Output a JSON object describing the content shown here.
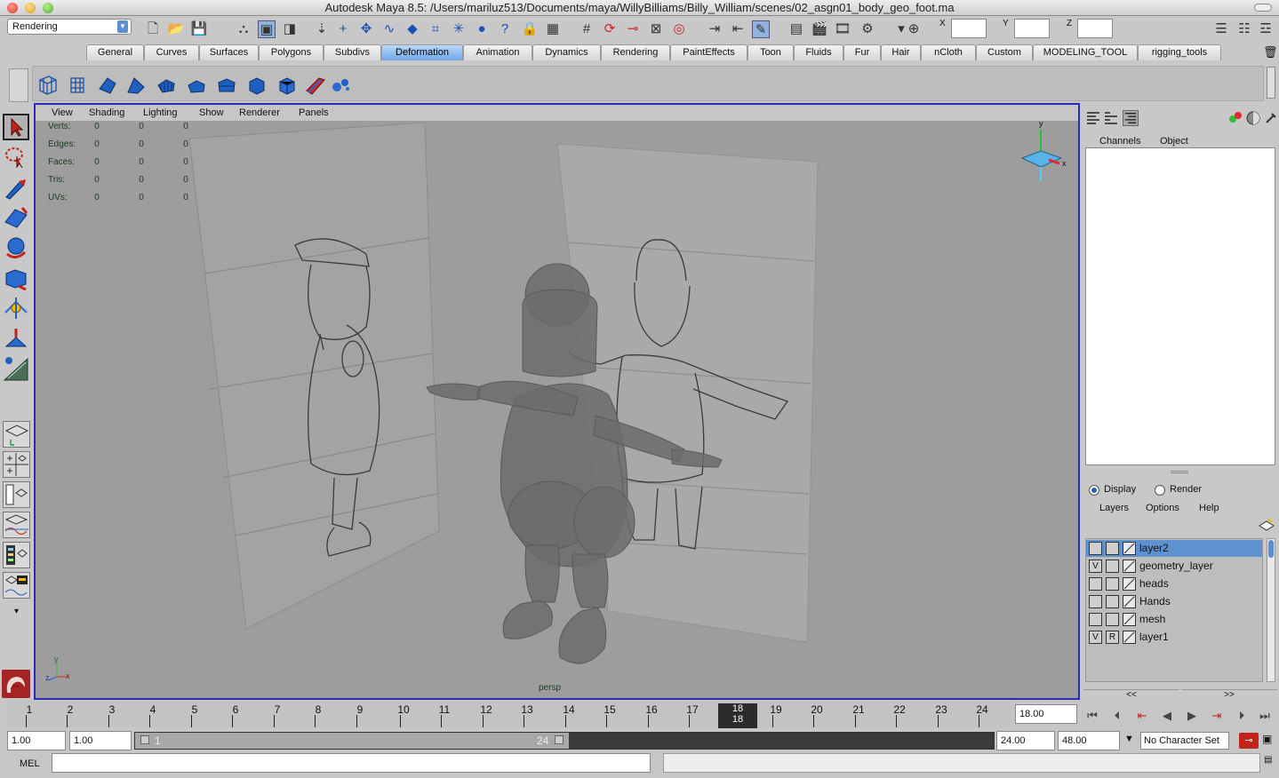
{
  "window": {
    "title": "Autodesk Maya 8.5: /Users/mariluz513/Documents/maya/WillyBilliams/Billy_William/scenes/02_asgn01_body_geo_foot.ma"
  },
  "status_line": {
    "menu_set": "Rendering",
    "x_label": "X",
    "y_label": "Y",
    "z_label": "Z",
    "x_value": "",
    "y_value": "",
    "z_value": ""
  },
  "shelf_tabs": [
    "General",
    "Curves",
    "Surfaces",
    "Polygons",
    "Subdivs",
    "Deformation",
    "Animation",
    "Dynamics",
    "Rendering",
    "PaintEffects",
    "Toon",
    "Fluids",
    "Fur",
    "Hair",
    "nCloth",
    "Custom",
    "MODELING_TOOL",
    "rigging_tools"
  ],
  "active_shelf_tab": "Deformation",
  "viewport": {
    "menu": [
      "View",
      "Shading",
      "Lighting",
      "Show",
      "Renderer",
      "Panels"
    ],
    "hud": [
      {
        "label": "Verts:",
        "values": [
          "0",
          "0",
          "0"
        ]
      },
      {
        "label": "Edges:",
        "values": [
          "0",
          "0",
          "0"
        ]
      },
      {
        "label": "Faces:",
        "values": [
          "0",
          "0",
          "0"
        ]
      },
      {
        "label": "Tris:",
        "values": [
          "0",
          "0",
          "0"
        ]
      },
      {
        "label": "UVs:",
        "values": [
          "0",
          "0",
          "0"
        ]
      }
    ],
    "camera_label": "persp",
    "view_cube_y": "y",
    "view_cube_x": "x",
    "axis_y": "y",
    "axis_z": "z",
    "axis_x": "x"
  },
  "channel_box": {
    "menu": [
      "Channels",
      "Object"
    ]
  },
  "layer_editor": {
    "modes": [
      "Display",
      "Render"
    ],
    "active_mode": "Display",
    "menu": [
      "Layers",
      "Options",
      "Help"
    ],
    "layers": [
      {
        "v": "",
        "p": "",
        "name": "layer2",
        "selected": true
      },
      {
        "v": "V",
        "p": "",
        "name": "geometry_layer",
        "selected": false
      },
      {
        "v": "",
        "p": "",
        "name": "heads",
        "selected": false
      },
      {
        "v": "",
        "p": "",
        "name": "Hands",
        "selected": false
      },
      {
        "v": "",
        "p": "",
        "name": "mesh",
        "selected": false
      },
      {
        "v": "V",
        "p": "R",
        "name": "layer1",
        "selected": false
      }
    ],
    "paging": [
      "<<",
      ">>"
    ]
  },
  "time_slider": {
    "ticks": [
      "1",
      "2",
      "3",
      "4",
      "5",
      "6",
      "7",
      "8",
      "9",
      "10",
      "11",
      "12",
      "13",
      "14",
      "15",
      "16",
      "17",
      "18",
      "19",
      "20",
      "21",
      "22",
      "23",
      "24"
    ],
    "current_frame": "18",
    "current_time_field": "18.00"
  },
  "range_slider": {
    "start_time": "1.00",
    "playback_start": "1.00",
    "range_start_label": "1",
    "range_end_label": "24",
    "playback_end": "24.00",
    "end_time": "48.00",
    "character_set": "No Character Set"
  },
  "command_line": {
    "label": "MEL",
    "input": ""
  },
  "colors": {
    "viewport_border": "#2b2bb5",
    "active_tab": "#6ea6e8",
    "selected_layer": "#5d92cf",
    "viewport_bg": "#9d9d9d"
  }
}
